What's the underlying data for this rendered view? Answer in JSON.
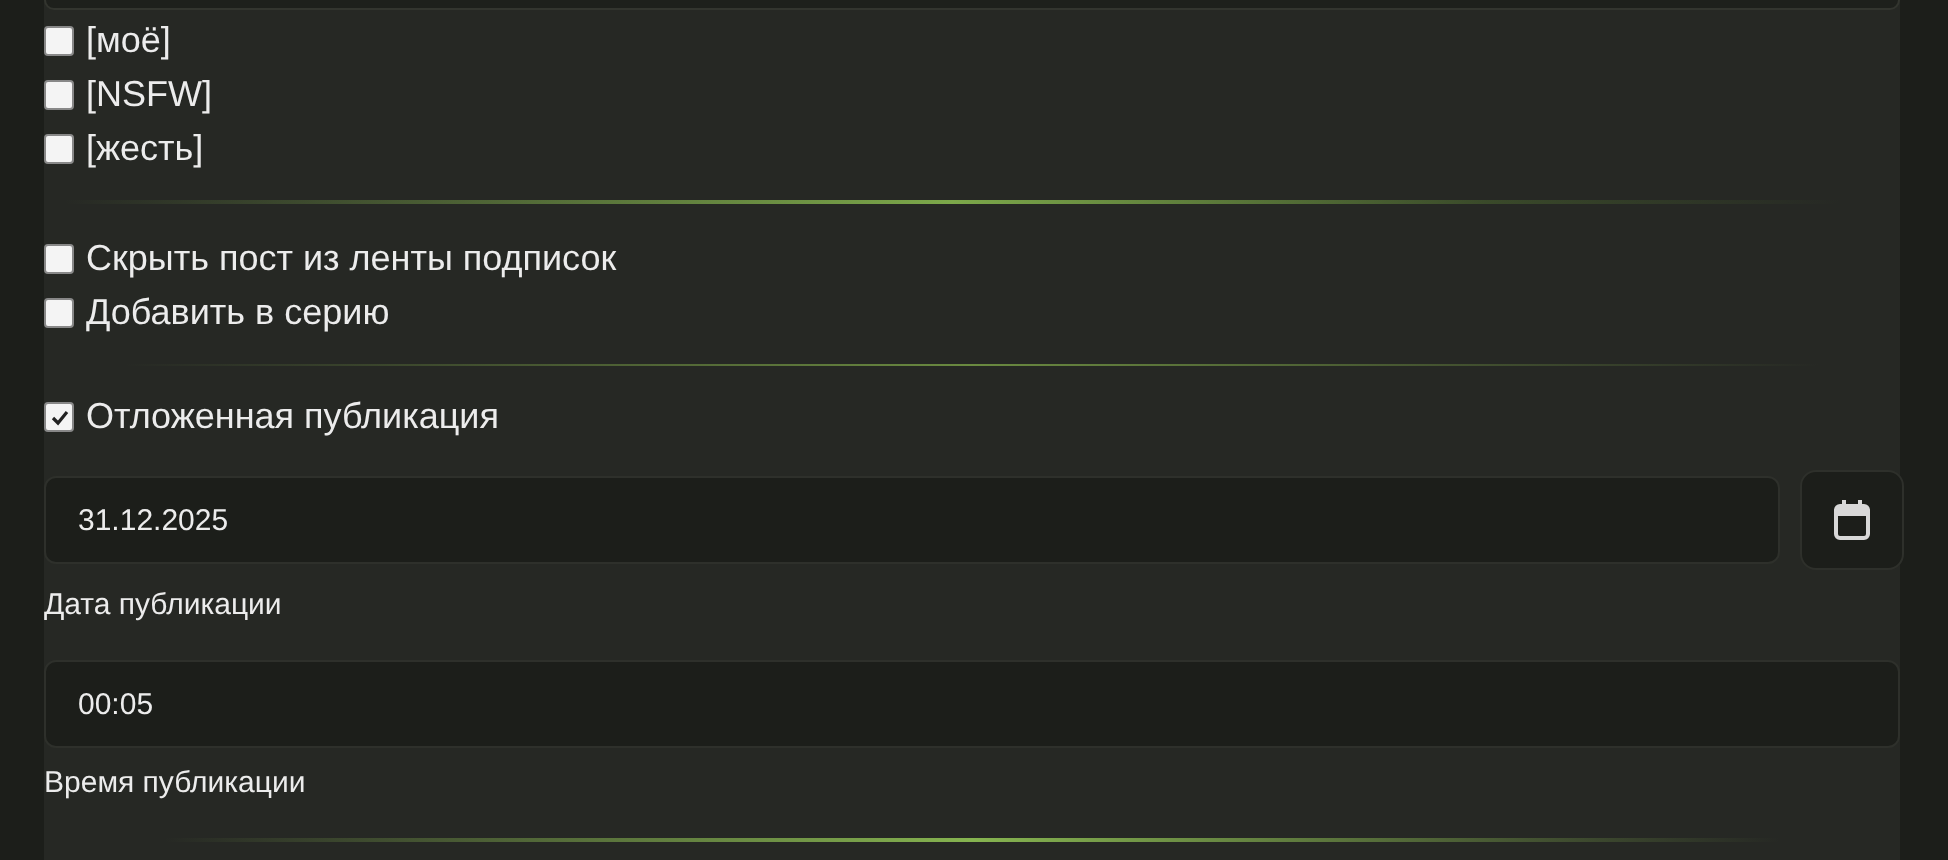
{
  "tags": [
    {
      "label": "[моё]",
      "checked": false
    },
    {
      "label": "[NSFW]",
      "checked": false
    },
    {
      "label": "[жесть]",
      "checked": false
    }
  ],
  "options": [
    {
      "label": "Скрыть пост из ленты подписок",
      "checked": false
    },
    {
      "label": "Добавить в серию",
      "checked": false
    }
  ],
  "delayed": {
    "label": "Отложенная публикация",
    "checked": true
  },
  "date": {
    "value": "31.12.2025",
    "label": "Дата публикации"
  },
  "time": {
    "value": "00:05",
    "label": "Время публикации"
  }
}
